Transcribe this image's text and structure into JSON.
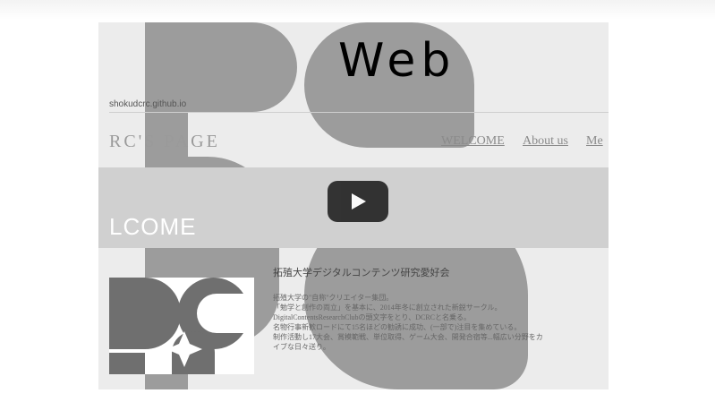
{
  "video": {
    "title": "Web",
    "play_label": "Play"
  },
  "webpage": {
    "url": "shokudcrc.github.io",
    "site_title": "RC'S PAGE",
    "nav": [
      "WELCOME",
      "About us",
      "Me"
    ],
    "banner": "LCOME",
    "heading": "拓殖大学デジタルコンテンツ研究愛好会",
    "description": [
      "拓殖大学の\"自称\"クリエイター集団。",
      "「勉学と創作の両立」を基本に、2014年冬に創立された新鋭サークル。",
      "DigitalContentsResearchClubの頭文字をとり、DCRCと名乗る。",
      "名物行事新歓ロードにて15名ほどの勧誘に成功、(一部で)注目を集めている。",
      "制作活動し17大会、賞模範戦、単位取得、ゲーム大会、開発合宿等...幅広い分野をカ",
      "イブな日々送り。"
    ],
    "logo_letters": "DCRC"
  },
  "colors": {
    "logo_gray": "#9c9c9c",
    "play_bg": "#212121"
  }
}
